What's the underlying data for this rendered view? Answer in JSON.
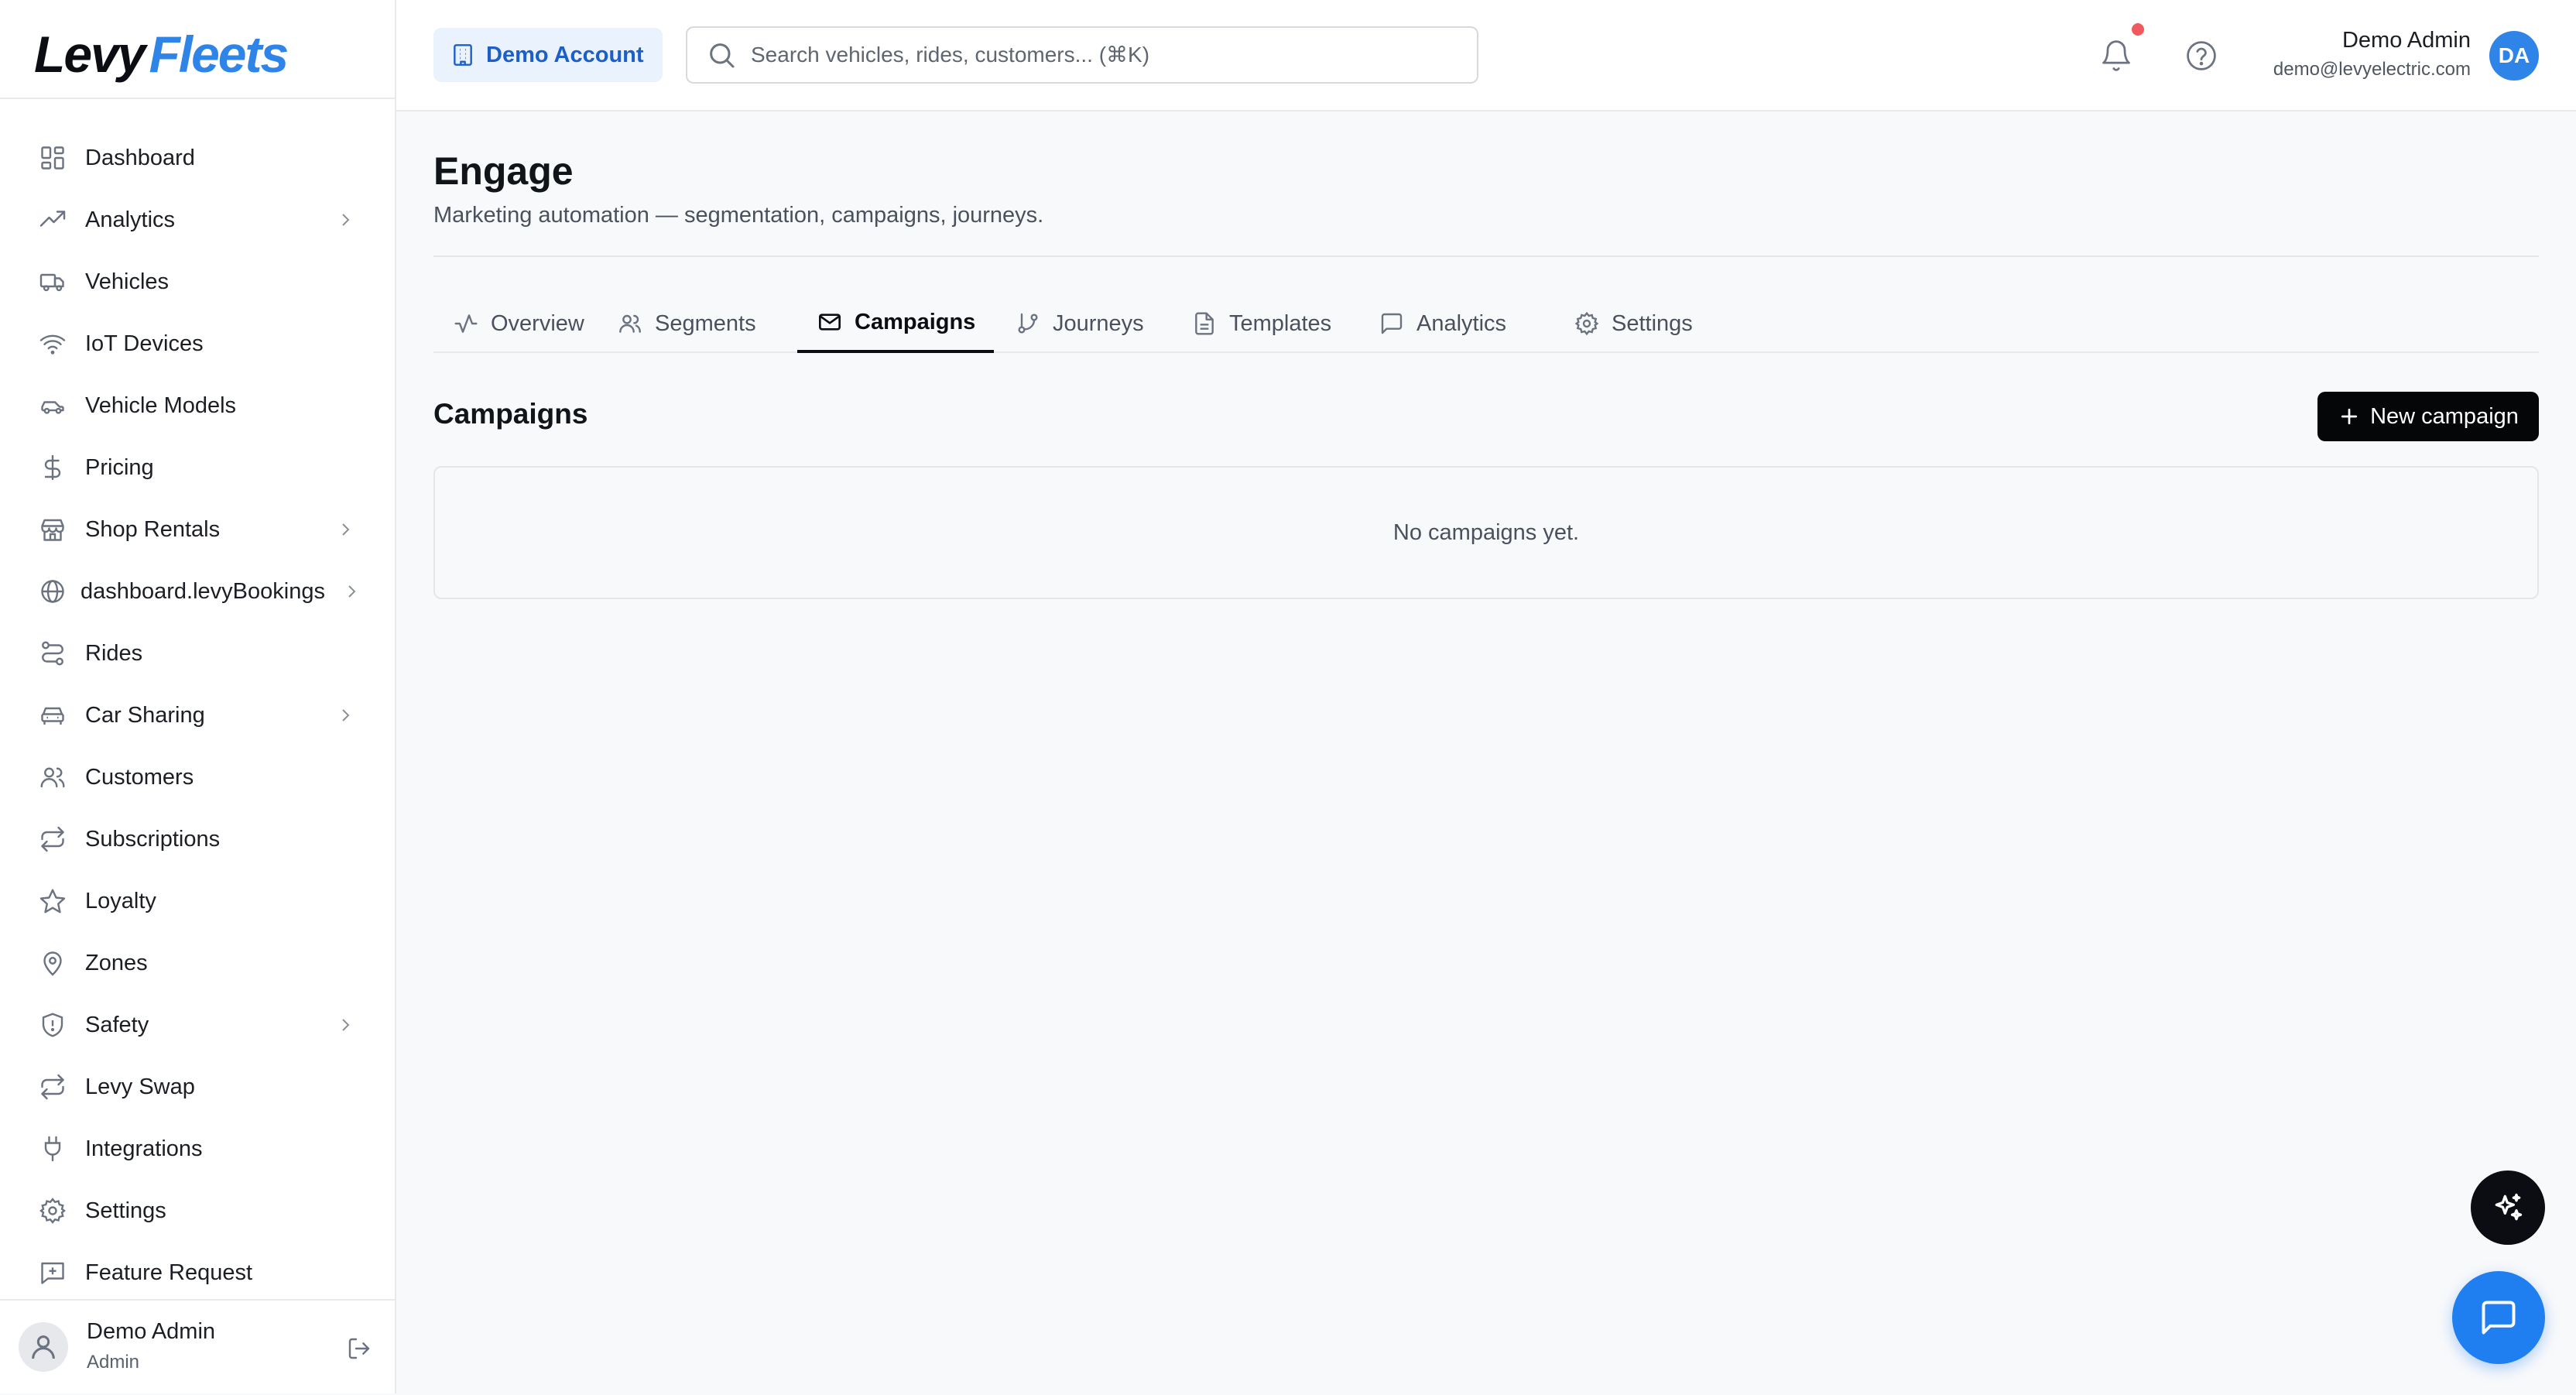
{
  "brand": {
    "part1": "Levy",
    "part2": "Fleets"
  },
  "sidebar": {
    "items": [
      {
        "label": "Dashboard",
        "icon": "dashboard-grid-icon",
        "has_children": false
      },
      {
        "label": "Analytics",
        "icon": "trending-up-icon",
        "has_children": true
      },
      {
        "label": "Vehicles",
        "icon": "truck-icon",
        "has_children": false
      },
      {
        "label": "IoT Devices",
        "icon": "wifi-icon",
        "has_children": false
      },
      {
        "label": "Vehicle Models",
        "icon": "car-icon",
        "has_children": false
      },
      {
        "label": "Pricing",
        "icon": "dollar-icon",
        "has_children": false
      },
      {
        "label": "Shop Rentals",
        "icon": "store-icon",
        "has_children": true
      },
      {
        "label": "dashboard.levyBookings",
        "icon": "globe-icon",
        "has_children": true
      },
      {
        "label": "Rides",
        "icon": "route-icon",
        "has_children": false
      },
      {
        "label": "Car Sharing",
        "icon": "car-front-icon",
        "has_children": true
      },
      {
        "label": "Customers",
        "icon": "users-icon",
        "has_children": false
      },
      {
        "label": "Subscriptions",
        "icon": "repeat-icon",
        "has_children": false
      },
      {
        "label": "Loyalty",
        "icon": "star-icon",
        "has_children": false
      },
      {
        "label": "Zones",
        "icon": "map-pin-icon",
        "has_children": false
      },
      {
        "label": "Safety",
        "icon": "shield-icon",
        "has_children": true
      },
      {
        "label": "Levy Swap",
        "icon": "swap-icon",
        "has_children": false
      },
      {
        "label": "Integrations",
        "icon": "plug-icon",
        "has_children": false
      },
      {
        "label": "Settings",
        "icon": "gear-icon",
        "has_children": false
      },
      {
        "label": "Feature Request",
        "icon": "message-plus-icon",
        "has_children": false
      }
    ],
    "footer": {
      "name": "Demo Admin",
      "role": "Admin"
    }
  },
  "header": {
    "account_label": "Demo Account",
    "search_placeholder": "Search vehicles, rides, customers... (⌘K)",
    "user": {
      "name": "Demo Admin",
      "email": "demo@levyelectric.com",
      "initials": "DA"
    },
    "has_notifications": true
  },
  "page": {
    "title": "Engage",
    "subtitle": "Marketing automation — segmentation, campaigns, journeys."
  },
  "tabs": [
    {
      "label": "Overview",
      "icon": "activity-icon",
      "active": false
    },
    {
      "label": "Segments",
      "icon": "users-icon",
      "active": false
    },
    {
      "label": "Campaigns",
      "icon": "mail-icon",
      "active": true
    },
    {
      "label": "Journeys",
      "icon": "git-branch-icon",
      "active": false
    },
    {
      "label": "Templates",
      "icon": "file-text-icon",
      "active": false
    },
    {
      "label": "Analytics",
      "icon": "message-square-icon",
      "active": false
    },
    {
      "label": "Settings",
      "icon": "gear-icon",
      "active": false
    }
  ],
  "campaigns": {
    "section_title": "Campaigns",
    "new_button_label": "New campaign",
    "empty_message": "No campaigns yet."
  },
  "colors": {
    "accent": "#2f84e8",
    "brand_dark": "#0b0d12",
    "notification_dot": "#f05a5f",
    "chat_button": "#1f7ef0"
  }
}
